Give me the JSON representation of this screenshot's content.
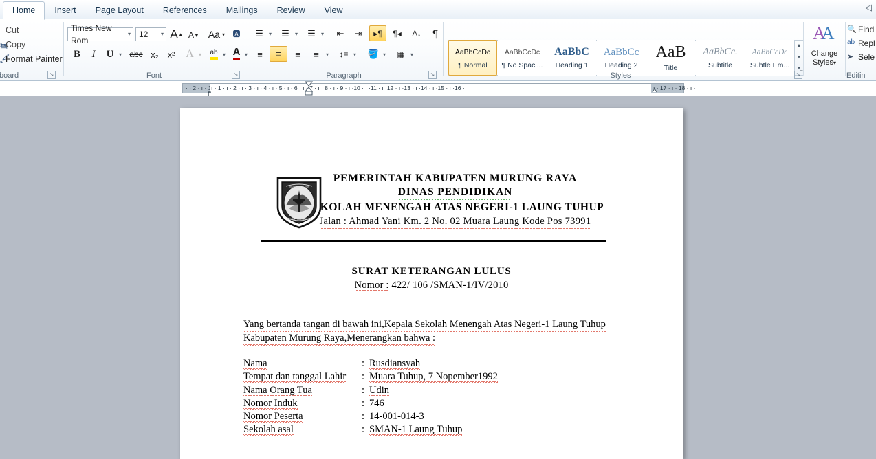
{
  "window": {
    "tabs": [
      {
        "label": "Home",
        "active": true
      },
      {
        "label": "Insert",
        "active": false
      },
      {
        "label": "Page Layout",
        "active": false
      },
      {
        "label": "References",
        "active": false
      },
      {
        "label": "Mailings",
        "active": false
      },
      {
        "label": "Review",
        "active": false
      },
      {
        "label": "View",
        "active": false
      }
    ],
    "corner_icon": "◁"
  },
  "ribbon": {
    "clipboard": {
      "label": "board",
      "full_label": "Clipboard",
      "items": [
        {
          "label": "Cut",
          "icon": "scissors-icon"
        },
        {
          "label": "Copy",
          "icon": "copy-icon"
        },
        {
          "label": "Format Painter",
          "icon": "paintbrush-icon"
        }
      ]
    },
    "font": {
      "label": "Font",
      "font_name": "Times New Rom",
      "font_size": "12",
      "grow_font": "A",
      "shrink_font": "A",
      "change_case": "Aa",
      "clear_formatting": "A̶",
      "bold": "B",
      "italic": "I",
      "underline": "U",
      "strikethrough": "abc",
      "subscript": "x₂",
      "superscript": "x²",
      "text_effects": "A",
      "highlight": "ab",
      "font_color": "A"
    },
    "paragraph": {
      "label": "Paragraph",
      "bullets": "bullet-list-icon",
      "numbering": "numbered-list-icon",
      "multilevel": "multilevel-list-icon",
      "decrease_indent": "decrease-indent-icon",
      "increase_indent": "increase-indent-icon",
      "ltr": "ltr-text-icon",
      "rtl": "rtl-text-icon",
      "sort": "sort-icon",
      "show_marks": "¶",
      "align_left": "align-left-icon",
      "align_center": "align-center-icon",
      "align_right": "align-right-icon",
      "justify": "justify-icon",
      "line_spacing": "line-spacing-icon",
      "shading": "shading-icon",
      "borders": "borders-icon"
    },
    "styles": {
      "label": "Styles",
      "items": [
        {
          "preview": "AaBbCcDc",
          "name": "¶ Normal",
          "selected": true,
          "style": "normal"
        },
        {
          "preview": "AaBbCcDc",
          "name": "¶ No Spaci...",
          "selected": false,
          "style": "normal"
        },
        {
          "preview": "AaBbC",
          "name": "Heading 1",
          "selected": false,
          "style": "h1"
        },
        {
          "preview": "AaBbCc",
          "name": "Heading 2",
          "selected": false,
          "style": "h2"
        },
        {
          "preview": "AaB",
          "name": "Title",
          "selected": false,
          "style": "title"
        },
        {
          "preview": "AaBbCc.",
          "name": "Subtitle",
          "selected": false,
          "style": "subtitle"
        },
        {
          "preview": "AaBbCcDc",
          "name": "Subtle Em...",
          "selected": false,
          "style": "subtle"
        }
      ],
      "scroll_up": "▲",
      "scroll_down": "▼",
      "more": "▼"
    },
    "change_styles": {
      "label_line1": "Change",
      "label_line2": "Styles",
      "icon": "change-styles-icon"
    },
    "editing": {
      "label": "Editin",
      "full_label": "Editing",
      "items": [
        {
          "label": "Find",
          "icon": "binoculars-icon"
        },
        {
          "label": "Repl",
          "icon": "replace-icon"
        },
        {
          "label": "Sele",
          "icon": "select-icon"
        }
      ]
    }
  },
  "ruler": {
    "left_marks": "·  ·  2  ·  ı  ·  1  ·  ı  ·  ı  ·",
    "marks": "ı · 1 · ı · 2 · ı · 3 · ı · 4 · ı · 5 · ı · 6 · ı · 7 · ı · 8 · ı · 9 · ı ·10 · ı ·11 · ı ·12 · ı ·13 · ı ·14 · ı ·15 · ı ·16 ·",
    "right_marks": "ı · 17 ·  ı · 18 · ı ·"
  },
  "document": {
    "letterhead": {
      "logo_alt": "school-crest-emblem",
      "line1": "PEMERINTAH  KABUPATEN  MURUNG  RAYA",
      "line2": "DINAS  PENDIDIKAN",
      "line3": "SEKOLAH  MENENGAH  ATAS NEGERI-1  LAUNG  TUHUP",
      "line4_prefix": "Jalan :",
      "line4": "Jalan :  Ahmad  Yani   Km.  2   No.  02 Muara  Laung Kode  Pos 73991"
    },
    "title": "SURAT  KETERANGAN  LULUS",
    "nomor_label": "Nomor :",
    "nomor_value": "422/ 106 /SMAN-1/IV/2010",
    "body_line1": "Yang  bertanda  tangan  di  bawah ini,Kepala   Sekolah  Menengah  Atas Negeri-1  Laung  Tuhup",
    "body_line2": "Kabupaten  Murung  Raya,Menerangkan  bahwa :",
    "fields": [
      {
        "label": "Nama",
        "colon": ":",
        "value": "Rusdiansyah"
      },
      {
        "label": "Tempat dan tanggal Lahir",
        "colon": ":",
        "value": "Muara  Tuhup, 7 Nopember1992"
      },
      {
        "label": "Nama Orang Tua",
        "colon": ":",
        "value": "Udin"
      },
      {
        "label": "Nomor Induk",
        "colon": ":",
        "value": "746"
      },
      {
        "label": "Nomor Peserta",
        "colon": ":",
        "value": "14-001-014-3"
      },
      {
        "label": "Sekolah asal",
        "colon": ":",
        "value": "SMAN-1  Laung  Tuhup"
      }
    ]
  },
  "colors": {
    "accent": "#e0a93c",
    "ribbon_bg": "#f2f6fa",
    "canvas_bg": "#b6bcc6",
    "page_bg": "#ffffff",
    "spell_error": "#d84a3a",
    "grammar_error": "#2f9b37"
  }
}
